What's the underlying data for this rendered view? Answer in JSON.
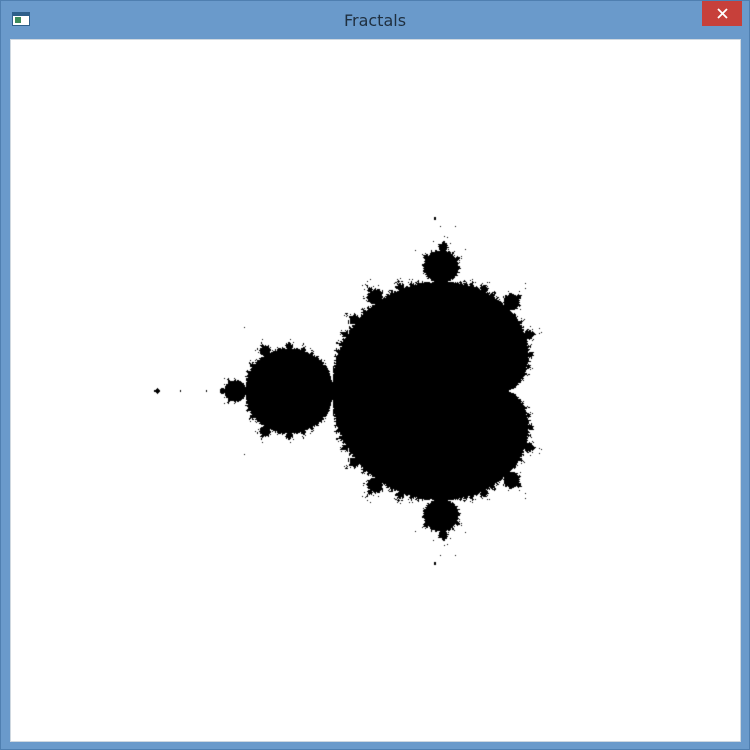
{
  "window": {
    "title": "Fractals",
    "icon": "app-window-icon",
    "close_icon": "close-icon",
    "colors": {
      "frame": "#6a9acb",
      "close_button": "#c7403a",
      "canvas_background": "#ffffff",
      "fractal_fill": "#000000"
    }
  },
  "canvas": {
    "content": "mandelbrot-set",
    "complex_view": {
      "re_min": -2.6,
      "re_max": 1.6,
      "im_min": -2.1,
      "im_max": 2.1
    },
    "max_iterations": 60
  }
}
